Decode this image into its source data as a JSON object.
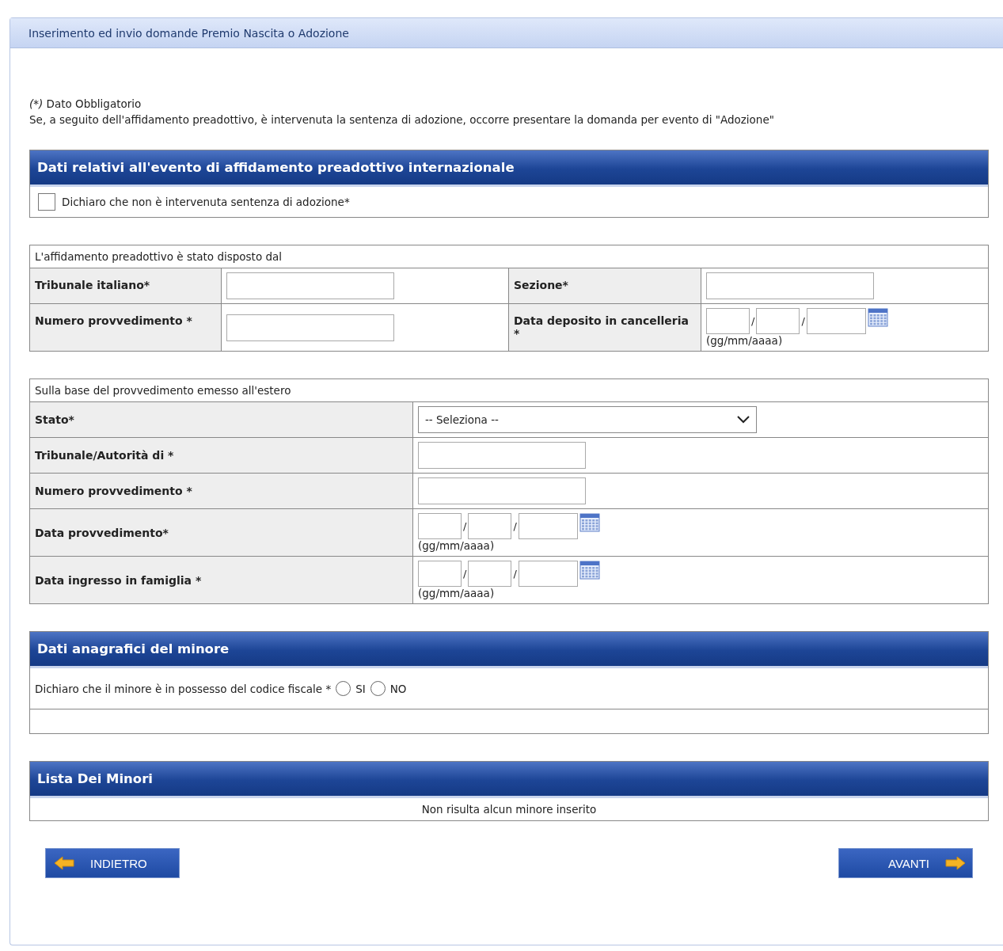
{
  "title": "Inserimento ed invio domande Premio Nascita o Adozione",
  "required_mark": "(*)",
  "required_note": "Dato Obbligatorio",
  "info": "Se, a seguito dell'affidamento preadottivo, è intervenuta la sentenza di adozione, occorre presentare la domanda per evento di \"Adozione\"",
  "event_section": {
    "header": "Dati relativi all'evento di affidamento preadottivo internazionale",
    "checkbox": {
      "label": "Dichiaro che non è intervenuta sentenza di adozione*",
      "checked": false
    }
  },
  "court_box": {
    "caption": "L'affidamento preadottivo è stato disposto dal",
    "fields": [
      {
        "label": "Tribunale italiano*",
        "kind": "text"
      },
      {
        "label": "Sezione*",
        "kind": "text"
      },
      {
        "label": "Numero provvedimento *",
        "kind": "text"
      },
      {
        "label": "Data deposito in cancelleria *",
        "kind": "date",
        "separators": [
          "/",
          "/"
        ],
        "hint": "(gg/mm/aaaa)"
      }
    ]
  },
  "foreign_box": {
    "caption": "Sulla base del provvedimento emesso all'estero",
    "fields": [
      {
        "label": "Stato*",
        "kind": "select",
        "value": "-- Seleziona --"
      },
      {
        "label": "Tribunale/Autorità di *",
        "kind": "text"
      },
      {
        "label": "Numero provvedimento *",
        "kind": "text"
      },
      {
        "label": "Data provvedimento*",
        "kind": "date",
        "separators": [
          "/",
          "/"
        ],
        "hint": "(gg/mm/aaaa)"
      },
      {
        "label": "Data ingresso in famiglia *",
        "kind": "date",
        "separators": [
          "/",
          "/"
        ],
        "hint": "(gg/mm/aaaa)"
      }
    ]
  },
  "minor_section": {
    "header": "Dati anagrafici del minore",
    "question": "Dichiaro che il minore è in possesso del codice fiscale *",
    "options": [
      {
        "label": "SI",
        "selected": false
      },
      {
        "label": "NO",
        "selected": false
      }
    ]
  },
  "list_section": {
    "header": "Lista Dei Minori",
    "empty_text": "Non risulta alcun minore inserito"
  },
  "buttons": [
    {
      "label": "INDIETRO",
      "kind": "back"
    },
    {
      "label": "AVANTI",
      "kind": "next"
    }
  ]
}
